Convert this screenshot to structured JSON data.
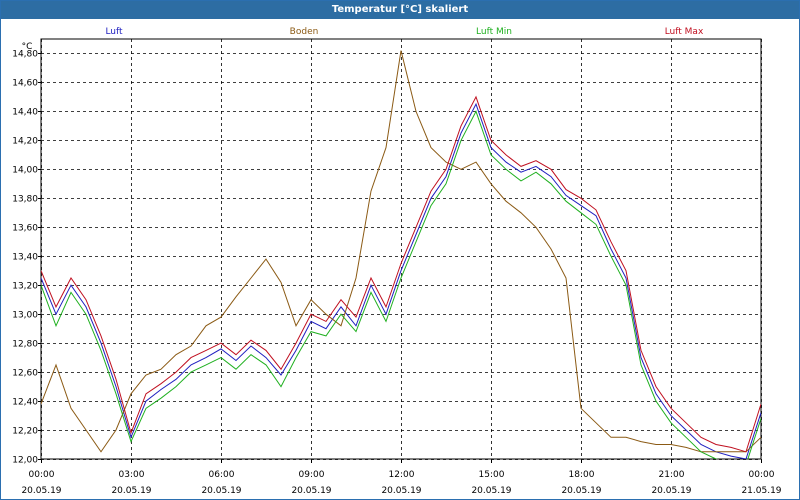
{
  "window": {
    "title": "Temperatur [°C] skaliert"
  },
  "chart_data": {
    "type": "line",
    "title": "Temperatur [°C] skaliert",
    "ylabel": "°C",
    "ylim": [
      12.0,
      14.9
    ],
    "yticks": [
      "12,00",
      "12,20",
      "12,40",
      "12,60",
      "12,80",
      "13,00",
      "13,20",
      "13,40",
      "13,60",
      "13,80",
      "14,00",
      "14,20",
      "14,40",
      "14,60",
      "14,80"
    ],
    "xlim": [
      0,
      24
    ],
    "xticks": [
      {
        "time": "00:00",
        "date": "20.05.19"
      },
      {
        "time": "03:00",
        "date": "20.05.19"
      },
      {
        "time": "06:00",
        "date": "20.05.19"
      },
      {
        "time": "09:00",
        "date": "20.05.19"
      },
      {
        "time": "12:00",
        "date": "20.05.19"
      },
      {
        "time": "15:00",
        "date": "20.05.19"
      },
      {
        "time": "18:00",
        "date": "20.05.19"
      },
      {
        "time": "21:00",
        "date": "20.05.19"
      },
      {
        "time": "00:00",
        "date": "21.05.19"
      }
    ],
    "grid": true,
    "legend": "top",
    "series": [
      {
        "name": "Luft",
        "color": "#2020c0",
        "x": [
          0,
          0.5,
          1,
          1.5,
          2,
          2.5,
          3,
          3.5,
          4,
          4.5,
          5,
          5.5,
          6,
          6.5,
          7,
          7.5,
          8,
          8.5,
          9,
          9.5,
          10,
          10.5,
          11,
          11.5,
          12,
          12.5,
          13,
          13.5,
          14,
          14.5,
          15,
          15.5,
          16,
          16.5,
          17,
          17.5,
          18,
          18.5,
          19,
          19.5,
          20,
          20.5,
          21,
          21.5,
          22,
          22.5,
          23,
          23.5,
          24
        ],
        "y": [
          13.25,
          13.0,
          13.2,
          13.05,
          12.8,
          12.5,
          12.15,
          12.4,
          12.48,
          12.55,
          12.65,
          12.7,
          12.76,
          12.68,
          12.78,
          12.7,
          12.58,
          12.75,
          12.95,
          12.9,
          13.05,
          12.92,
          13.2,
          13.0,
          13.3,
          13.55,
          13.8,
          13.95,
          14.25,
          14.45,
          14.15,
          14.05,
          13.98,
          14.02,
          13.95,
          13.82,
          13.75,
          13.68,
          13.45,
          13.25,
          12.7,
          12.45,
          12.3,
          12.2,
          12.1,
          12.05,
          12.02,
          12.0,
          12.32
        ]
      },
      {
        "name": "Boden",
        "color": "#8b5a14",
        "x": [
          0,
          0.5,
          1,
          1.5,
          2,
          2.5,
          3,
          3.5,
          4,
          4.5,
          5,
          5.5,
          6,
          6.5,
          7,
          7.5,
          8,
          8.5,
          9,
          9.5,
          10,
          10.5,
          11,
          11.5,
          12,
          12.5,
          13,
          13.5,
          14,
          14.5,
          15,
          15.5,
          16,
          16.5,
          17,
          17.5,
          18,
          18.5,
          19,
          19.5,
          20,
          20.5,
          21,
          21.5,
          22,
          22.5,
          23,
          23.5,
          24
        ],
        "y": [
          12.38,
          12.65,
          12.35,
          12.2,
          12.05,
          12.2,
          12.45,
          12.58,
          12.62,
          12.72,
          12.78,
          12.92,
          12.98,
          13.12,
          13.25,
          13.38,
          13.22,
          12.92,
          13.1,
          13.0,
          12.92,
          13.25,
          13.85,
          14.15,
          14.82,
          14.4,
          14.15,
          14.05,
          14.0,
          14.05,
          13.9,
          13.78,
          13.7,
          13.6,
          13.45,
          13.25,
          12.35,
          12.25,
          12.15,
          12.15,
          12.12,
          12.1,
          12.1,
          12.08,
          12.05,
          12.05,
          12.05,
          12.05,
          12.15
        ]
      },
      {
        "name": "Luft Min",
        "color": "#20b020",
        "x": [
          0,
          0.5,
          1,
          1.5,
          2,
          2.5,
          3,
          3.5,
          4,
          4.5,
          5,
          5.5,
          6,
          6.5,
          7,
          7.5,
          8,
          8.5,
          9,
          9.5,
          10,
          10.5,
          11,
          11.5,
          12,
          12.5,
          13,
          13.5,
          14,
          14.5,
          15,
          15.5,
          16,
          16.5,
          17,
          17.5,
          18,
          18.5,
          19,
          19.5,
          20,
          20.5,
          21,
          21.5,
          22,
          22.5,
          23,
          23.5,
          24
        ],
        "y": [
          13.2,
          12.92,
          13.15,
          13.0,
          12.75,
          12.45,
          12.12,
          12.35,
          12.42,
          12.5,
          12.6,
          12.65,
          12.7,
          12.62,
          12.72,
          12.65,
          12.5,
          12.7,
          12.88,
          12.85,
          13.0,
          12.88,
          13.15,
          12.95,
          13.25,
          13.5,
          13.75,
          13.9,
          14.2,
          14.4,
          14.1,
          14.0,
          13.92,
          13.98,
          13.9,
          13.78,
          13.7,
          13.62,
          13.4,
          13.2,
          12.65,
          12.4,
          12.25,
          12.15,
          12.05,
          12.0,
          11.98,
          11.96,
          12.28
        ]
      },
      {
        "name": "Luft Max",
        "color": "#c01020",
        "x": [
          0,
          0.5,
          1,
          1.5,
          2,
          2.5,
          3,
          3.5,
          4,
          4.5,
          5,
          5.5,
          6,
          6.5,
          7,
          7.5,
          8,
          8.5,
          9,
          9.5,
          10,
          10.5,
          11,
          11.5,
          12,
          12.5,
          13,
          13.5,
          14,
          14.5,
          15,
          15.5,
          16,
          16.5,
          17,
          17.5,
          18,
          18.5,
          19,
          19.5,
          20,
          20.5,
          21,
          21.5,
          22,
          22.5,
          23,
          23.5,
          24
        ],
        "y": [
          13.3,
          13.05,
          13.25,
          13.1,
          12.85,
          12.55,
          12.18,
          12.45,
          12.52,
          12.6,
          12.7,
          12.75,
          12.8,
          12.72,
          12.82,
          12.75,
          12.62,
          12.8,
          13.0,
          12.95,
          13.1,
          12.98,
          13.25,
          13.05,
          13.35,
          13.6,
          13.85,
          14.0,
          14.3,
          14.5,
          14.2,
          14.1,
          14.02,
          14.06,
          14.0,
          13.86,
          13.8,
          13.72,
          13.5,
          13.3,
          12.75,
          12.5,
          12.35,
          12.25,
          12.15,
          12.1,
          12.08,
          12.05,
          12.38
        ]
      }
    ]
  }
}
